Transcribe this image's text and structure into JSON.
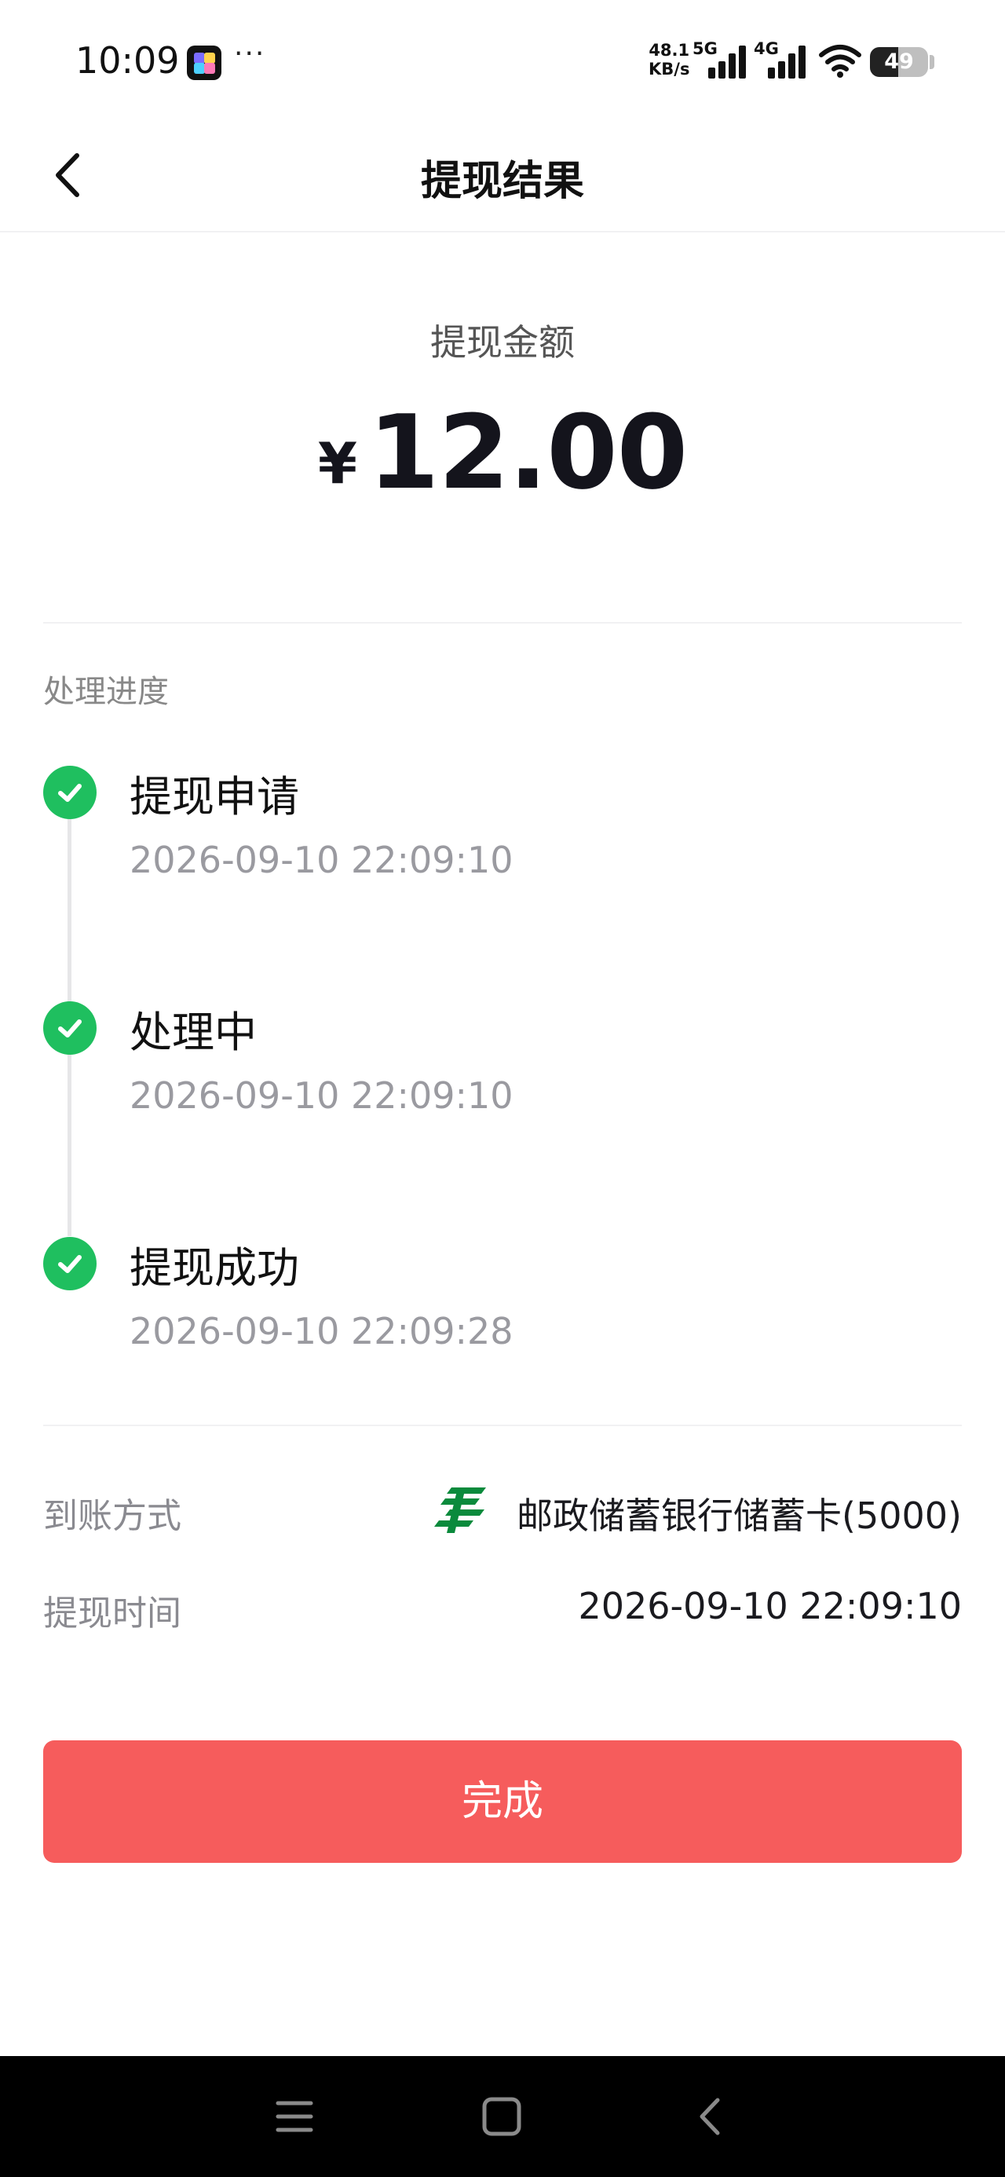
{
  "status_bar": {
    "time": "10:09",
    "net_speed_value": "48.1",
    "net_speed_unit": "KB/s",
    "net_5g": "5G",
    "net_4g": "4G",
    "battery": "49"
  },
  "header": {
    "title": "提现结果"
  },
  "amount": {
    "label": "提现金额",
    "currency": "¥",
    "value": "12.00"
  },
  "progress": {
    "title": "处理进度",
    "steps": [
      {
        "title": "提现申请",
        "time": "2026-09-10 22:09:10"
      },
      {
        "title": "处理中",
        "time": "2026-09-10 22:09:10"
      },
      {
        "title": "提现成功",
        "time": "2026-09-10 22:09:28"
      }
    ]
  },
  "details": {
    "method_label": "到账方式",
    "method_value": "邮政储蓄银行储蓄卡(5000)",
    "time_label": "提现时间",
    "time_value": "2026-09-10 22:09:10"
  },
  "done_button": "完成",
  "colors": {
    "success": "#1fbf5f",
    "primary_button": "#f65c5c",
    "bank_logo": "#0a8a3c"
  }
}
